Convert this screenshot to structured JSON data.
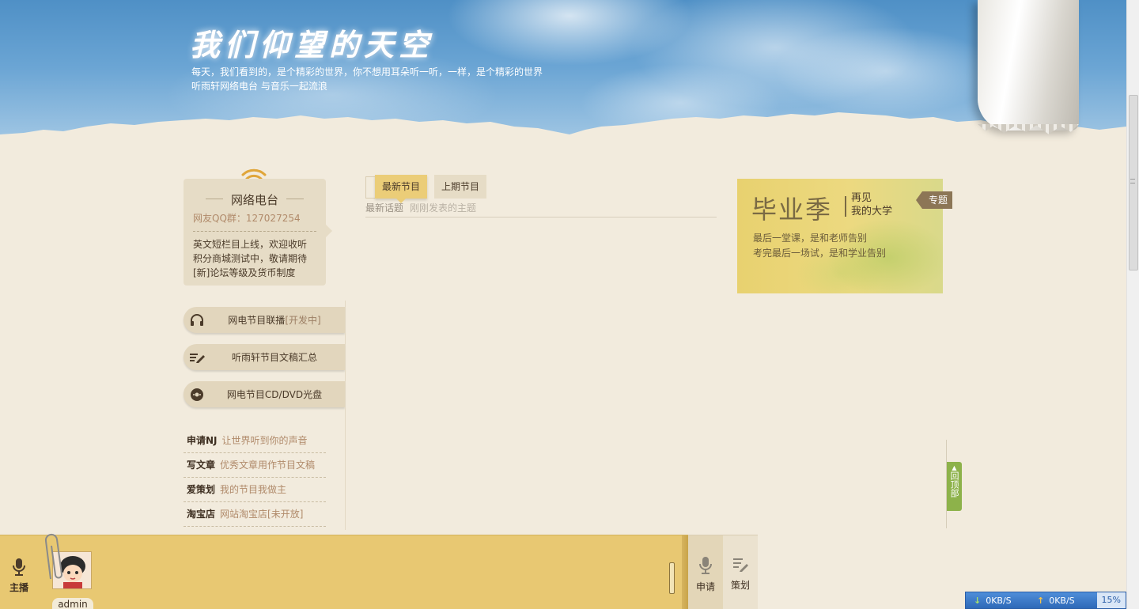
{
  "header": {
    "title": "我们仰望的天空",
    "subtitle_line1": "每天，我们看到的，是个精彩的世界，你不想用耳朵听一听，一样，是个精彩的世界",
    "subtitle_line2": "听雨轩网络电台 与音乐一起流浪"
  },
  "radio": {
    "title": "网络电台",
    "qq": "网友QQ群：127027254",
    "news": [
      "英文短栏目上线，欢迎收听",
      "积分商城测试中，敬请期待",
      "[新]论坛等级及货币制度"
    ]
  },
  "side_buttons": [
    {
      "label": "网电节目联播",
      "extra": "[开发中]",
      "icon": "headphones-icon"
    },
    {
      "label": "听雨轩节目文稿汇总",
      "extra": "",
      "icon": "pencil-icon"
    },
    {
      "label": "网电节目CD/DVD光盘",
      "extra": "",
      "icon": "disc-icon"
    }
  ],
  "side_links": [
    {
      "title": "申请NJ",
      "desc": "让世界听到你的声音"
    },
    {
      "title": "写文章",
      "desc": "优秀文章用作节目文稿"
    },
    {
      "title": "爱策划",
      "desc": "我的节目我做主"
    },
    {
      "title": "淘宝店",
      "desc": "网站淘宝店[未开放]"
    }
  ],
  "tabs": {
    "active": "最新节目",
    "inactive": "上期节目",
    "topic_label": "最新话题",
    "topic_desc": "刚刚发表的主题"
  },
  "banner": {
    "big": "毕业季",
    "small_line1": "再见",
    "small_line2": "我的大学",
    "tag": "专题",
    "desc_line1": "最后一堂课，是和老师告别",
    "desc_line2": "考完最后一场试，是和学业告别"
  },
  "back_top": {
    "label": "回顶部"
  },
  "player": {
    "nj_label": "主播",
    "username": "admin",
    "apply_label": "申请",
    "plan_label": "策划"
  },
  "speed": {
    "down": "0KB/S",
    "up": "0KB/S",
    "percent": "15%"
  },
  "colors": {
    "page_bg": "#f2ebdd",
    "accent_yellow": "#ebcd78",
    "tab_bg": "#e6dcc6",
    "back_top_green": "#8db24a",
    "speed_blue": "#2e69b8"
  }
}
